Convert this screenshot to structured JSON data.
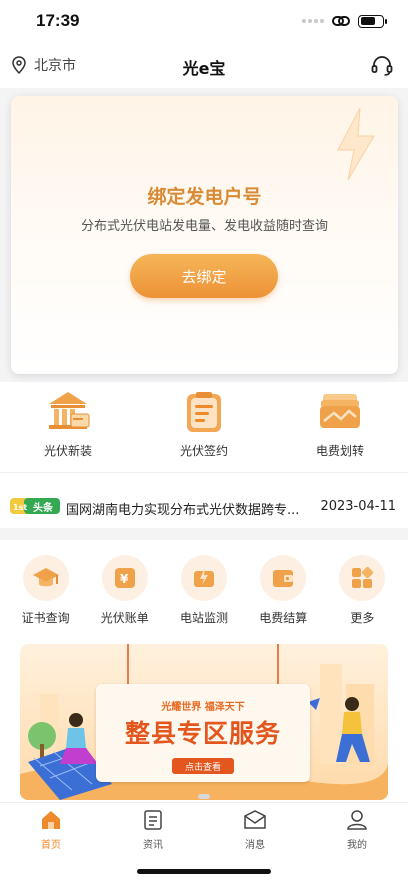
{
  "status_bar": {
    "time": "17:39"
  },
  "nav": {
    "location": "北京市",
    "title": "光e宝"
  },
  "bind_card": {
    "title": "绑定发电户号",
    "subtitle": "分布式光伏电站发电量、发电收益随时查询",
    "button": "去绑定"
  },
  "quick_entries": [
    {
      "label": "光伏新装",
      "icon": "bank-building-icon"
    },
    {
      "label": "光伏签约",
      "icon": "document-clipboard-icon"
    },
    {
      "label": "电费划转",
      "icon": "wallet-transfer-icon"
    }
  ],
  "news": {
    "badge": "头条",
    "text": "国网湖南电力实现分布式光伏数据跨专...",
    "date": "2023-04-11"
  },
  "services": [
    {
      "label": "证书查询",
      "icon": "graduation-cap-icon"
    },
    {
      "label": "光伏账单",
      "icon": "bill-yen-icon"
    },
    {
      "label": "电站监测",
      "icon": "power-monitor-icon"
    },
    {
      "label": "电费结算",
      "icon": "wallet-icon"
    },
    {
      "label": "更多",
      "icon": "grid-more-icon"
    }
  ],
  "banner": {
    "slogan": "光耀世界  福泽天下",
    "title": "整县专区服务",
    "button": "点击查看"
  },
  "tabs": [
    {
      "label": "首页",
      "icon": "home-icon",
      "active": true
    },
    {
      "label": "资讯",
      "icon": "news-icon",
      "active": false
    },
    {
      "label": "消息",
      "icon": "message-icon",
      "active": false
    },
    {
      "label": "我的",
      "icon": "profile-icon",
      "active": false
    }
  ],
  "colors": {
    "accent": "#ee8a2c",
    "title_orange": "#d98a35",
    "banner_red": "#e3561d"
  }
}
